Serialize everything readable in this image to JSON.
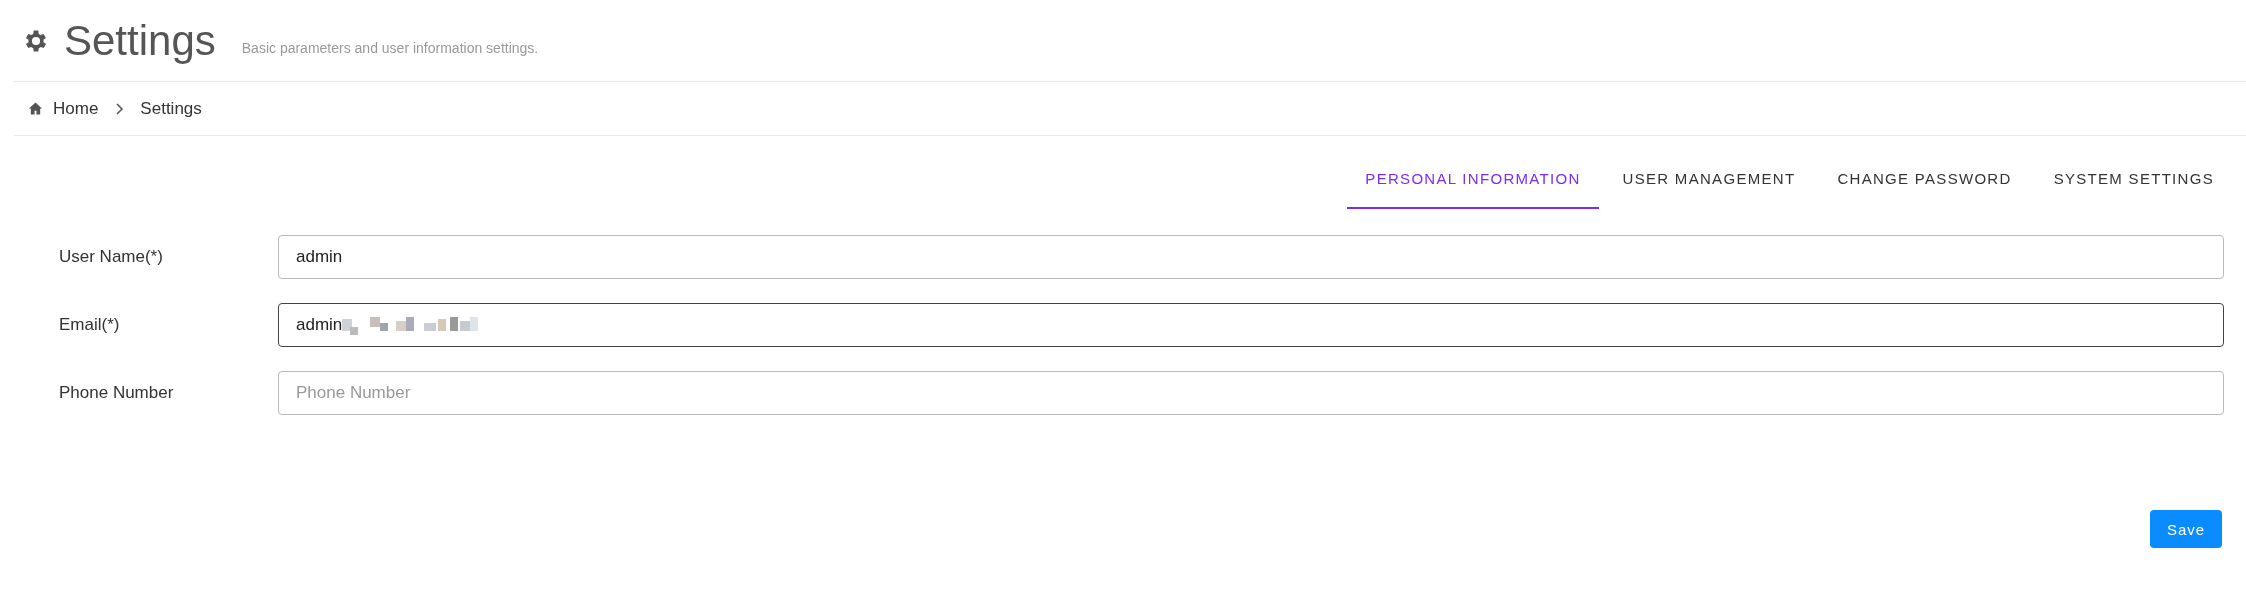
{
  "header": {
    "title": "Settings",
    "subtitle": "Basic parameters and user information settings."
  },
  "breadcrumb": [
    {
      "label": "Home",
      "kind": "home"
    },
    {
      "label": "Settings",
      "kind": "page"
    }
  ],
  "tabs": [
    {
      "label": "PERSONAL INFORMATION",
      "selected": true
    },
    {
      "label": "USER MANAGEMENT",
      "selected": false
    },
    {
      "label": "CHANGE PASSWORD",
      "selected": false
    },
    {
      "label": "SYSTEM SETTINGS",
      "selected": false
    }
  ],
  "form": [
    {
      "label": "User Name(*)",
      "value": "admin",
      "focused": false,
      "redacted": false
    },
    {
      "label": "Email(*)",
      "value": "admin",
      "focused": true,
      "redacted": true
    },
    {
      "label": "Phone Number",
      "placeholder": "Phone Number",
      "focused": false,
      "redacted": false
    }
  ],
  "save_button": "Save"
}
